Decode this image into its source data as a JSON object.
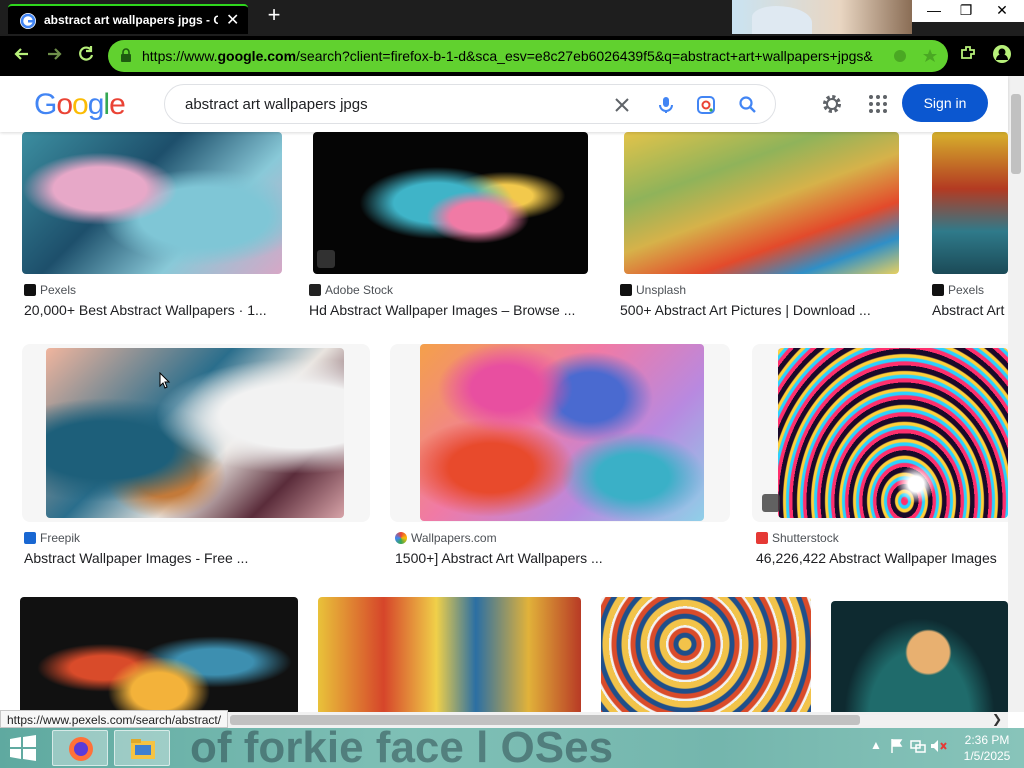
{
  "browser": {
    "tab_title": "abstract art wallpapers jpgs - Goo",
    "url_prefix": "https://www.",
    "url_domain": "google.com",
    "url_rest": "/search?client=firefox-b-1-d&sca_esv=e8c27eb6026439f5&q=abstract+art+wallpapers+jpgs&",
    "status_url": "https://www.pexels.com/search/abstract/",
    "accent_color": "#61d12f"
  },
  "google": {
    "logo_letters": [
      "G",
      "o",
      "o",
      "g",
      "l",
      "e"
    ],
    "logo_colors": [
      "#4285f4",
      "#ea4335",
      "#fbbc05",
      "#4285f4",
      "#34a853",
      "#ea4335"
    ],
    "search_query": "abstract art wallpapers jpgs",
    "signin_label": "Sign in"
  },
  "results": {
    "row1": [
      {
        "source": "Pexels",
        "caption": "20,000+ Best Abstract Wallpapers · 1..."
      },
      {
        "source": "Adobe Stock",
        "caption": "Hd Abstract Wallpaper Images – Browse ..."
      },
      {
        "source": "Unsplash",
        "caption": "500+ Abstract Art Pictures | Download ..."
      },
      {
        "source": "Pexels",
        "caption": "Abstract Art"
      }
    ],
    "row2": [
      {
        "source": "Freepik",
        "caption": "Abstract Wallpaper Images - Free ..."
      },
      {
        "source": "Wallpapers.com",
        "caption": "1500+] Abstract Art Wallpapers ..."
      },
      {
        "source": "Shutterstock",
        "caption": "46,226,422 Abstract Wallpaper Images"
      }
    ]
  },
  "taskbar": {
    "banner_text": "of forkie face   l OSes",
    "time": "2:36 PM",
    "date": "1/5/2025"
  }
}
